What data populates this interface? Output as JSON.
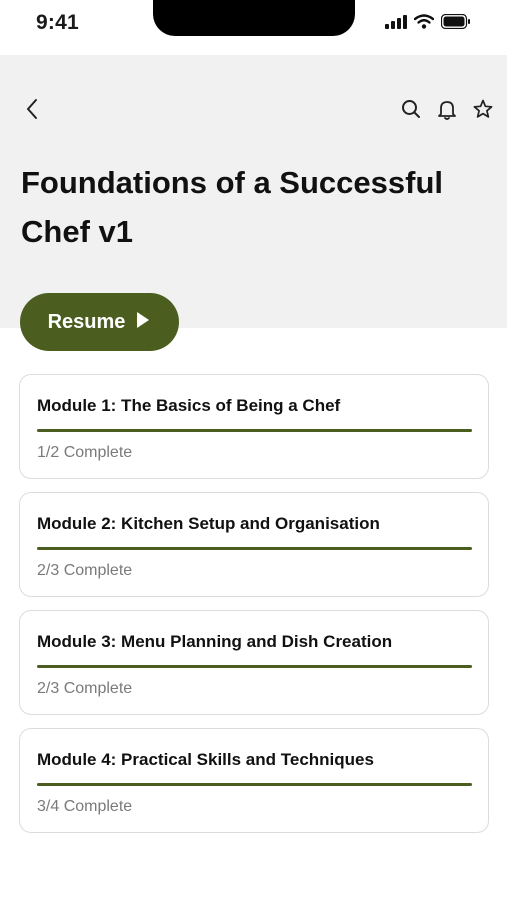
{
  "status_bar": {
    "time": "9:41"
  },
  "course": {
    "title": "Foundations of a Successful Chef v1"
  },
  "actions": {
    "back_icon": "chevron-left-icon",
    "search_icon": "search-icon",
    "notifications_icon": "bell-icon",
    "favorite_icon": "star-icon"
  },
  "resume": {
    "label": "Resume",
    "icon": "play-icon"
  },
  "colors": {
    "accent": "#4b5e1f",
    "header_bg": "#f1f1f1",
    "muted_text": "#7a7a7a"
  },
  "modules": [
    {
      "title": "Module 1: The Basics of Being a Chef",
      "status": "1/2 Complete",
      "progress": 1.0
    },
    {
      "title": "Module 2: Kitchen Setup and Organisation",
      "status": "2/3 Complete",
      "progress": 1.0
    },
    {
      "title": "Module 3: Menu Planning and Dish Creation",
      "status": "2/3 Complete",
      "progress": 1.0
    },
    {
      "title": "Module 4: Practical Skills and Techniques",
      "status": "3/4 Complete",
      "progress": 1.0
    }
  ]
}
